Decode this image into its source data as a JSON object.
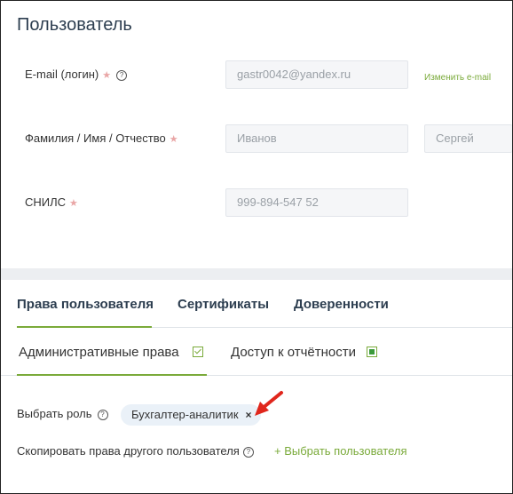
{
  "section": {
    "title": "Пользователь"
  },
  "email": {
    "label": "E-mail (логин)",
    "value": "gastr0042@yandex.ru",
    "change_link": "Изменить e-mail"
  },
  "name": {
    "label": "Фамилия / Имя / Отчество",
    "last_name": "Иванов",
    "first_name": "Сергей"
  },
  "snils": {
    "label": "СНИЛС",
    "value": "999-894-547 52"
  },
  "tabs": [
    "Права пользователя",
    "Сертификаты",
    "Доверенности"
  ],
  "subtabs": [
    {
      "label": "Административные права",
      "checked": true
    },
    {
      "label": "Доступ к отчётности",
      "checked": true
    }
  ],
  "role": {
    "label": "Выбрать роль",
    "chip": "Бухгалтер-аналитик"
  },
  "copy": {
    "label": "Скопировать права другого пользователя",
    "link": "+ Выбрать пользователя"
  },
  "colors": {
    "accent": "#7aaa3a",
    "arrow": "#e0261c"
  }
}
